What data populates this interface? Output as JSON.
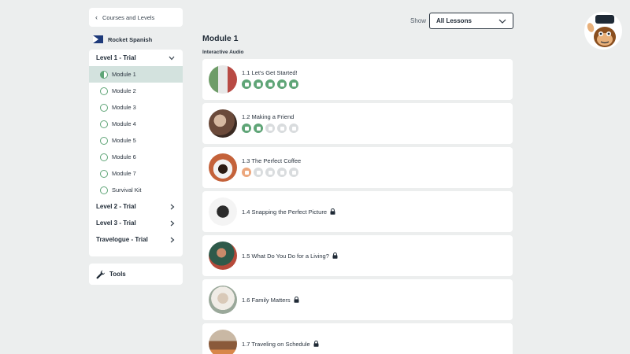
{
  "back_link": {
    "label": "Courses and Levels"
  },
  "brand": {
    "name": "Rocket Spanish"
  },
  "sidebar": {
    "level1": {
      "label": "Level 1 - Trial"
    },
    "modules": [
      {
        "label": "Module 1",
        "active": true
      },
      {
        "label": "Module 2"
      },
      {
        "label": "Module 3"
      },
      {
        "label": "Module 4"
      },
      {
        "label": "Module 5"
      },
      {
        "label": "Module 6"
      },
      {
        "label": "Module 7"
      },
      {
        "label": "Survival Kit"
      }
    ],
    "levels": [
      {
        "label": "Level 2 - Trial"
      },
      {
        "label": "Level 3 - Trial"
      },
      {
        "label": "Travelogue - Trial"
      }
    ],
    "tools": {
      "label": "Tools"
    }
  },
  "filter": {
    "label": "Show",
    "selected": "All Lessons"
  },
  "main": {
    "module_title": "Module 1",
    "section_title": "Interactive Audio",
    "lessons": [
      {
        "title": "1.1 Let's Get Started!",
        "locked": false,
        "progress": "all-complete"
      },
      {
        "title": "1.2 Making a Friend",
        "locked": false,
        "progress": "two-complete"
      },
      {
        "title": "1.3 The Perfect Coffee",
        "locked": false,
        "progress": "in-progress"
      },
      {
        "title": "1.4 Snapping the Perfect Picture",
        "locked": true
      },
      {
        "title": "1.5 What Do You Do for a Living?",
        "locked": true
      },
      {
        "title": "1.6 Family Matters",
        "locked": true
      },
      {
        "title": "1.7 Traveling on Schedule",
        "locked": true
      }
    ]
  },
  "colors": {
    "accent_green": "#5fa577",
    "active_bg": "#d3e2de",
    "in_progress_orange": "#eca77d",
    "inactive_grey": "#d9dcde"
  }
}
